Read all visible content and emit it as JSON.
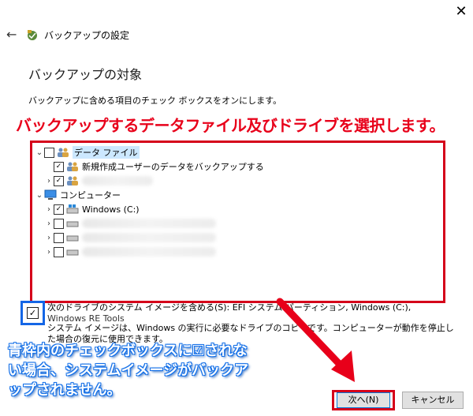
{
  "window": {
    "title": "バックアップの設定"
  },
  "section_title": "バックアップの対象",
  "instruction": "バックアップに含める項目のチェック ボックスをオンにします。",
  "annotations": {
    "top": "バックアップするデータファイル及びドライブを選択します。",
    "bottom": "青枠内のチェックボックスに☑されない場合、システムイメージがバックアップされません。"
  },
  "tree": {
    "data_files": {
      "label": "データ ファイル",
      "child1_label": "新規作成ユーザーのデータをバックアップする"
    },
    "computer": {
      "label": "コンピューター",
      "drive_c": "Windows (C:)"
    }
  },
  "system_image": {
    "label": "次のドライブのシステム イメージを含める(S): EFI システム パーティション, Windows (C:),",
    "sub_label": "Windows RE Tools",
    "description": "システム イメージは、Windows の実行に必要なドライブのコピーです。コンピューターが動作を停止した場合の復元に使用できます。",
    "checked": true
  },
  "buttons": {
    "next": "次へ(N)",
    "cancel": "キャンセル"
  },
  "colors": {
    "annotation_red": "#e8001a",
    "annotation_blue": "#1470e8",
    "selection": "#cce8ff"
  }
}
